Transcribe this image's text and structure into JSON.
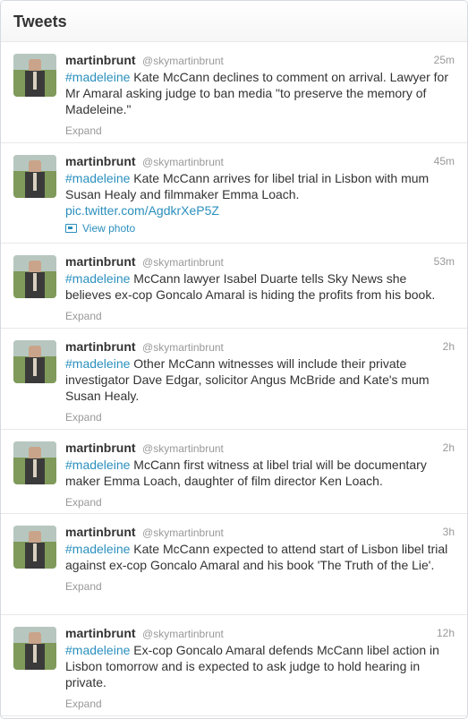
{
  "header": {
    "title": "Tweets"
  },
  "tweets": [
    {
      "name": "martinbrunt",
      "handle": "@skymartinbrunt",
      "time": "25m",
      "hashtag": "#madeleine",
      "text": " Kate McCann declines to comment on arrival. Lawyer for Mr Amaral asking judge to ban media \"to preserve the memory of Madeleine.\"",
      "expand": "Expand"
    },
    {
      "name": "martinbrunt",
      "handle": "@skymartinbrunt",
      "time": "45m",
      "hashtag": "#madeleine",
      "text": " Kate McCann arrives for libel trial in Lisbon with mum Susan Healy and filmmaker Emma Loach.",
      "link": "pic.twitter.com/AgdkrXeP5Z",
      "view_photo": "View photo"
    },
    {
      "name": "martinbrunt",
      "handle": "@skymartinbrunt",
      "time": "53m",
      "hashtag": "#madeleine",
      "text": " McCann lawyer Isabel Duarte tells Sky News she believes ex-cop Goncalo Amaral is hiding the profits from his book.",
      "expand": "Expand"
    },
    {
      "name": "martinbrunt",
      "handle": "@skymartinbrunt",
      "time": "2h",
      "hashtag": "#madeleine",
      "text": " Other McCann witnesses will include their private investigator Dave Edgar, solicitor Angus McBride and Kate's mum Susan Healy.",
      "expand": "Expand"
    },
    {
      "name": "martinbrunt",
      "handle": "@skymartinbrunt",
      "time": "2h",
      "hashtag": "#madeleine",
      "text": " McCann first witness at libel trial will be documentary maker Emma Loach, daughter of film director Ken Loach.",
      "expand": "Expand"
    },
    {
      "name": "martinbrunt",
      "handle": "@skymartinbrunt",
      "time": "3h",
      "hashtag": "#madeleine",
      "text": " Kate McCann expected to attend start of Lisbon libel trial against ex-cop Goncalo Amaral and his book 'The Truth of the Lie'.",
      "expand": "Expand"
    },
    {
      "name": "martinbrunt",
      "handle": "@skymartinbrunt",
      "time": "12h",
      "hashtag": "#madeleine",
      "text": " Ex-cop Goncalo Amaral defends McCann libel action in Lisbon tomorrow and is expected to ask judge to hold hearing in private.",
      "expand": "Expand"
    }
  ],
  "icons": {
    "avatar": "avatar-photo",
    "view_photo": "photo-icon"
  },
  "colors": {
    "hashtag": "#2a8fbd",
    "muted": "#999999",
    "text": "#333333"
  }
}
